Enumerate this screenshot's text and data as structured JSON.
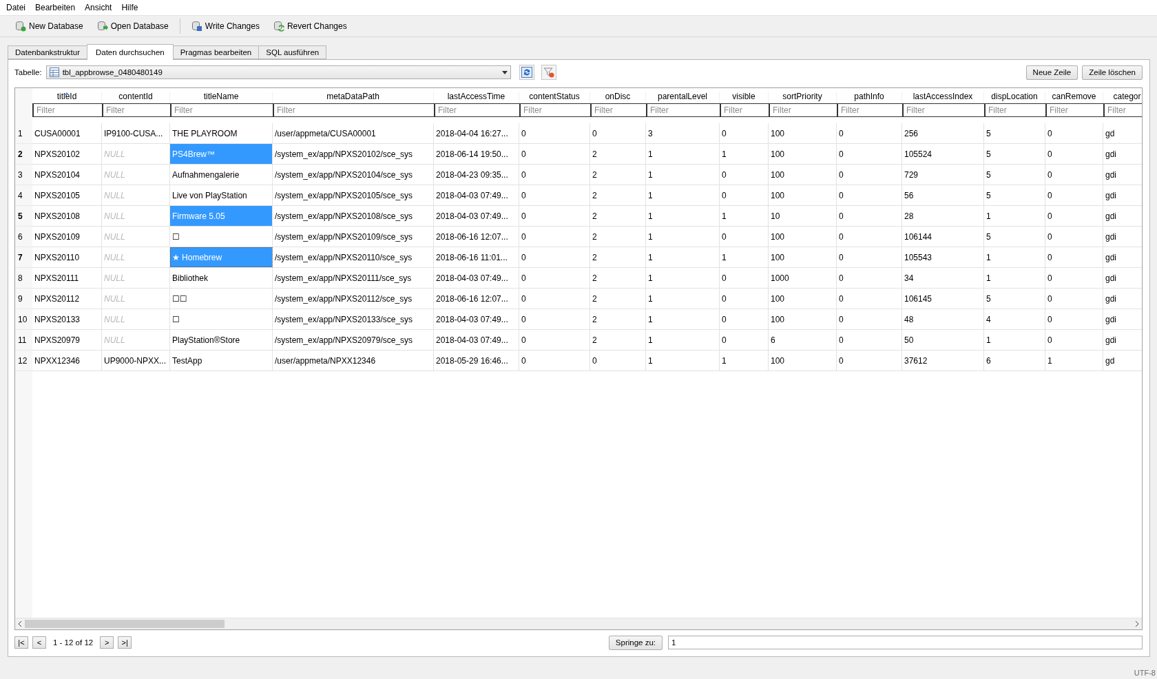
{
  "menu": [
    "Datei",
    "Bearbeiten",
    "Ansicht",
    "Hilfe"
  ],
  "toolbar": [
    {
      "label": "New Database",
      "kind": "new"
    },
    {
      "label": "Open Database",
      "kind": "open"
    },
    {
      "label": "Write Changes",
      "kind": "write"
    },
    {
      "label": "Revert Changes",
      "kind": "revert"
    }
  ],
  "tabs": [
    {
      "label": "Datenbankstruktur",
      "selected": false
    },
    {
      "label": "Daten durchsuchen",
      "selected": true
    },
    {
      "label": "Pragmas bearbeiten",
      "selected": false
    },
    {
      "label": "SQL ausführen",
      "selected": false
    }
  ],
  "table_select": {
    "label": "Tabelle:",
    "value": "tbl_appbrowse_0480480149"
  },
  "actions": [
    "Neue Zeile",
    "Zeile löschen"
  ],
  "table": {
    "columns": [
      {
        "name": "titleId",
        "filter_placeholder": "Filter",
        "sorted": true
      },
      {
        "name": "contentId",
        "filter_placeholder": "Filter",
        "sorted": false
      },
      {
        "name": "titleName",
        "filter_placeholder": "Filter",
        "sorted": false
      },
      {
        "name": "metaDataPath",
        "filter_placeholder": "Filter",
        "sorted": false
      },
      {
        "name": "lastAccessTime",
        "filter_placeholder": "Filter",
        "sorted": false
      },
      {
        "name": "contentStatus",
        "filter_placeholder": "Filter",
        "sorted": false
      },
      {
        "name": "onDisc",
        "filter_placeholder": "Filter",
        "sorted": false
      },
      {
        "name": "parentalLevel",
        "filter_placeholder": "Filter",
        "sorted": false
      },
      {
        "name": "visible",
        "filter_placeholder": "Filter",
        "sorted": false
      },
      {
        "name": "sortPriority",
        "filter_placeholder": "Filter",
        "sorted": false
      },
      {
        "name": "pathInfo",
        "filter_placeholder": "Filter",
        "sorted": false
      },
      {
        "name": "lastAccessIndex",
        "filter_placeholder": "Filter",
        "sorted": false
      },
      {
        "name": "dispLocation",
        "filter_placeholder": "Filter",
        "sorted": false
      },
      {
        "name": "canRemove",
        "filter_placeholder": "Filter",
        "sorted": false
      },
      {
        "name": "categor",
        "filter_placeholder": "Filter",
        "sorted": false
      }
    ],
    "rows": [
      {
        "number": "1",
        "selected": false,
        "cells": [
          "CUSA00001",
          "IP9100-CUSA...",
          "THE PLAYROOM",
          "/user/appmeta/CUSA00001",
          "2018-04-04 16:27...",
          "0",
          "0",
          "3",
          "0",
          "100",
          "0",
          "256",
          "5",
          "0",
          "gd"
        ]
      },
      {
        "number": "2",
        "selected": true,
        "cells": [
          "NPXS20102",
          {
            "text": "NULL",
            "null": true
          },
          {
            "text": "PS4Brew™",
            "selected": true,
            "current": false
          },
          "/system_ex/app/NPXS20102/sce_sys",
          "2018-06-14 19:50...",
          "0",
          "2",
          "1",
          "1",
          "100",
          "0",
          "105524",
          "5",
          "0",
          "gdi"
        ]
      },
      {
        "number": "3",
        "selected": false,
        "cells": [
          "NPXS20104",
          {
            "text": "NULL",
            "null": true
          },
          "Aufnahmengalerie",
          "/system_ex/app/NPXS20104/sce_sys",
          "2018-04-23 09:35...",
          "0",
          "2",
          "1",
          "0",
          "100",
          "0",
          "729",
          "5",
          "0",
          "gdi"
        ]
      },
      {
        "number": "4",
        "selected": false,
        "cells": [
          "NPXS20105",
          {
            "text": "NULL",
            "null": true
          },
          "Live von PlayStation",
          "/system_ex/app/NPXS20105/sce_sys",
          "2018-04-03 07:49...",
          "0",
          "2",
          "1",
          "0",
          "100",
          "0",
          "56",
          "5",
          "0",
          "gdi"
        ]
      },
      {
        "number": "5",
        "selected": true,
        "cells": [
          "NPXS20108",
          {
            "text": "NULL",
            "null": true
          },
          {
            "text": "Firmware 5.05",
            "selected": true,
            "current": false
          },
          "/system_ex/app/NPXS20108/sce_sys",
          "2018-04-03 07:49...",
          "0",
          "2",
          "1",
          "1",
          "10",
          "0",
          "28",
          "1",
          "0",
          "gdi"
        ]
      },
      {
        "number": "6",
        "selected": false,
        "cells": [
          "NPXS20109",
          {
            "text": "NULL",
            "null": true
          },
          "☐",
          "/system_ex/app/NPXS20109/sce_sys",
          "2018-06-16 12:07...",
          "0",
          "2",
          "1",
          "0",
          "100",
          "0",
          "106144",
          "5",
          "0",
          "gdi"
        ]
      },
      {
        "number": "7",
        "selected": true,
        "cells": [
          "NPXS20110",
          {
            "text": "NULL",
            "null": true
          },
          {
            "text": "★ Homebrew",
            "selected": true,
            "current": true
          },
          "/system_ex/app/NPXS20110/sce_sys",
          "2018-06-16 11:01...",
          "0",
          "2",
          "1",
          "1",
          "100",
          "0",
          "105543",
          "1",
          "0",
          "gdi"
        ]
      },
      {
        "number": "8",
        "selected": false,
        "cells": [
          "NPXS20111",
          {
            "text": "NULL",
            "null": true
          },
          "Bibliothek",
          "/system_ex/app/NPXS20111/sce_sys",
          "2018-04-03 07:49...",
          "0",
          "2",
          "1",
          "0",
          "1000",
          "0",
          "34",
          "1",
          "0",
          "gdi"
        ]
      },
      {
        "number": "9",
        "selected": false,
        "cells": [
          "NPXS20112",
          {
            "text": "NULL",
            "null": true
          },
          "☐☐",
          "/system_ex/app/NPXS20112/sce_sys",
          "2018-06-16 12:07...",
          "0",
          "2",
          "1",
          "0",
          "100",
          "0",
          "106145",
          "5",
          "0",
          "gdi"
        ]
      },
      {
        "number": "10",
        "selected": false,
        "cells": [
          "NPXS20133",
          {
            "text": "NULL",
            "null": true
          },
          "☐",
          "/system_ex/app/NPXS20133/sce_sys",
          "2018-04-03 07:49...",
          "0",
          "2",
          "1",
          "0",
          "100",
          "0",
          "48",
          "4",
          "0",
          "gdi"
        ]
      },
      {
        "number": "11",
        "selected": false,
        "cells": [
          "NPXS20979",
          {
            "text": "NULL",
            "null": true
          },
          "PlayStation®Store",
          "/system_ex/app/NPXS20979/sce_sys",
          "2018-04-03 07:49...",
          "0",
          "2",
          "1",
          "0",
          "6",
          "0",
          "50",
          "1",
          "0",
          "gdi"
        ]
      },
      {
        "number": "12",
        "selected": false,
        "cells": [
          "NPXX12346",
          "UP9000-NPXX...",
          "TestApp",
          "/user/appmeta/NPXX12346",
          "2018-05-29 16:46...",
          "0",
          "0",
          "1",
          "1",
          "100",
          "0",
          "37612",
          "6",
          "1",
          "gd"
        ]
      }
    ]
  },
  "navigation": {
    "buttons": [
      "|<",
      "<",
      ">",
      ">|"
    ],
    "range": "1 - 12 of 12",
    "goto_label": "Springe zu:",
    "goto_value": "1"
  },
  "status_bar": "UTF-8"
}
